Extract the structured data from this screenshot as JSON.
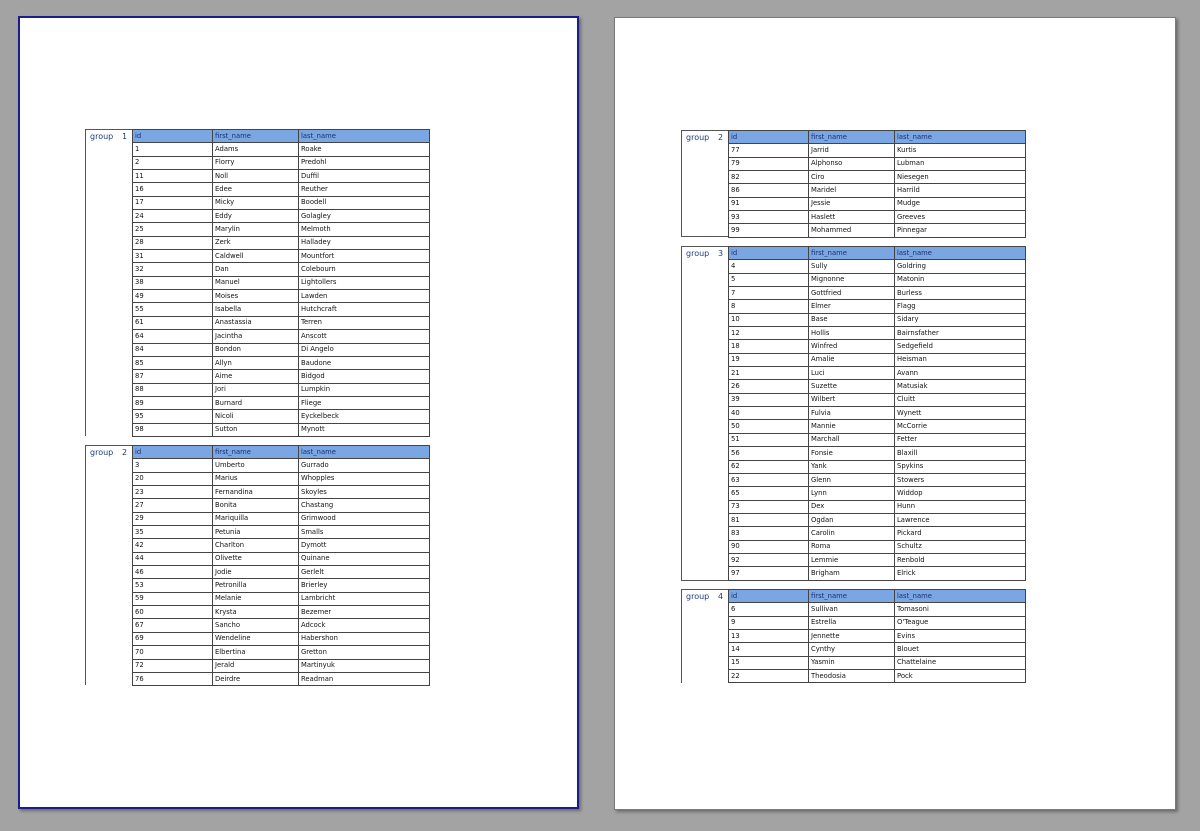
{
  "pages": [
    {
      "groups": [
        {
          "label": "group",
          "value": "1",
          "headers": [
            "id",
            "first_name",
            "last_name"
          ],
          "rows": [
            [
              "1",
              "Adams",
              "Roake"
            ],
            [
              "2",
              "Florry",
              "Predohl"
            ],
            [
              "11",
              "Noll",
              "Duffil"
            ],
            [
              "16",
              "Edee",
              "Reuther"
            ],
            [
              "17",
              "Micky",
              "Boodell"
            ],
            [
              "24",
              "Eddy",
              "Golagley"
            ],
            [
              "25",
              "Marylin",
              "Melmoth"
            ],
            [
              "28",
              "Zerk",
              "Halladey"
            ],
            [
              "31",
              "Caldwell",
              "Mountfort"
            ],
            [
              "32",
              "Dan",
              "Colebourn"
            ],
            [
              "38",
              "Manuel",
              "Lightollers"
            ],
            [
              "49",
              "Moises",
              "Lawden"
            ],
            [
              "55",
              "Isabella",
              "Hutchcraft"
            ],
            [
              "61",
              "Anastassia",
              "Terren"
            ],
            [
              "64",
              "Jacintha",
              "Anscott"
            ],
            [
              "84",
              "Bondon",
              "Di Angelo"
            ],
            [
              "85",
              "Allyn",
              "Baudone"
            ],
            [
              "87",
              "Aime",
              "Bidgod"
            ],
            [
              "88",
              "Jori",
              "Lumpkin"
            ],
            [
              "89",
              "Burnard",
              "Fliege"
            ],
            [
              "95",
              "Nicoli",
              "Eyckelbeck"
            ],
            [
              "98",
              "Sutton",
              "Mynott"
            ]
          ]
        },
        {
          "label": "group",
          "value": "2",
          "headers": [
            "id",
            "first_name",
            "last_name"
          ],
          "rows": [
            [
              "3",
              "Umberto",
              "Gurrado"
            ],
            [
              "20",
              "Marius",
              "Whopples"
            ],
            [
              "23",
              "Fernandina",
              "Skoyles"
            ],
            [
              "27",
              "Bonita",
              "Chastang"
            ],
            [
              "29",
              "Mariquilla",
              "Grimwood"
            ],
            [
              "35",
              "Petunia",
              "Smalls"
            ],
            [
              "42",
              "Charlton",
              "Dymott"
            ],
            [
              "44",
              "Olivette",
              "Quinane"
            ],
            [
              "46",
              "Jodie",
              "Gerlelt"
            ],
            [
              "53",
              "Petronilla",
              "Brierley"
            ],
            [
              "59",
              "Melanie",
              "Lambricht"
            ],
            [
              "60",
              "Krysta",
              "Bezemer"
            ],
            [
              "67",
              "Sancho",
              "Adcock"
            ],
            [
              "69",
              "Wendeline",
              "Habershon"
            ],
            [
              "70",
              "Elbertina",
              "Gretton"
            ],
            [
              "72",
              "Jerald",
              "Martinyuk"
            ],
            [
              "76",
              "Deirdre",
              "Readman"
            ]
          ]
        }
      ]
    },
    {
      "groups": [
        {
          "label": "group",
          "value": "2",
          "headers": [
            "id",
            "first_name",
            "last_name"
          ],
          "rows": [
            [
              "77",
              "Jarrid",
              "Kurtis"
            ],
            [
              "79",
              "Alphonso",
              "Lubman"
            ],
            [
              "82",
              "Ciro",
              "Niesegen"
            ],
            [
              "86",
              "Maridel",
              "Harrild"
            ],
            [
              "91",
              "Jessie",
              "Mudge"
            ],
            [
              "93",
              "Haslett",
              "Greeves"
            ],
            [
              "99",
              "Mohammed",
              "Pinnegar"
            ]
          ]
        },
        {
          "label": "group",
          "value": "3",
          "headers": [
            "id",
            "first_name",
            "last_name"
          ],
          "rows": [
            [
              "4",
              "Sully",
              "Goldring"
            ],
            [
              "5",
              "Mignonne",
              "Matonin"
            ],
            [
              "7",
              "Gottfried",
              "Burless"
            ],
            [
              "8",
              "Elmer",
              "Flagg"
            ],
            [
              "10",
              "Base",
              "Sidary"
            ],
            [
              "12",
              "Hollis",
              "Bairnsfather"
            ],
            [
              "18",
              "Winfred",
              "Sedgefield"
            ],
            [
              "19",
              "Amalie",
              "Heisman"
            ],
            [
              "21",
              "Luci",
              "Avann"
            ],
            [
              "26",
              "Suzette",
              "Matusiak"
            ],
            [
              "39",
              "Wilbert",
              "Cluitt"
            ],
            [
              "40",
              "Fulvia",
              "Wynett"
            ],
            [
              "50",
              "Mannie",
              "McCorrie"
            ],
            [
              "51",
              "Marchall",
              "Fetter"
            ],
            [
              "56",
              "Fonsie",
              "Blaxill"
            ],
            [
              "62",
              "Yank",
              "Spykins"
            ],
            [
              "63",
              "Glenn",
              "Stowers"
            ],
            [
              "65",
              "Lynn",
              "Widdop"
            ],
            [
              "73",
              "Dex",
              "Hunn"
            ],
            [
              "81",
              "Ogdan",
              "Lawrence"
            ],
            [
              "83",
              "Carolin",
              "Pickard"
            ],
            [
              "90",
              "Roma",
              "Schultz"
            ],
            [
              "92",
              "Lemmie",
              "Renbold"
            ],
            [
              "97",
              "Brigham",
              "Elrick"
            ]
          ]
        },
        {
          "label": "group",
          "value": "4",
          "headers": [
            "id",
            "first_name",
            "last_name"
          ],
          "rows": [
            [
              "6",
              "Sullivan",
              "Tomasoni"
            ],
            [
              "9",
              "Estrella",
              "O'Teague"
            ],
            [
              "13",
              "Jennette",
              "Evins"
            ],
            [
              "14",
              "Cynthy",
              "Blouet"
            ],
            [
              "15",
              "Yasmin",
              "Chattelaine"
            ],
            [
              "22",
              "Theodosia",
              "Pock"
            ]
          ]
        }
      ]
    }
  ]
}
